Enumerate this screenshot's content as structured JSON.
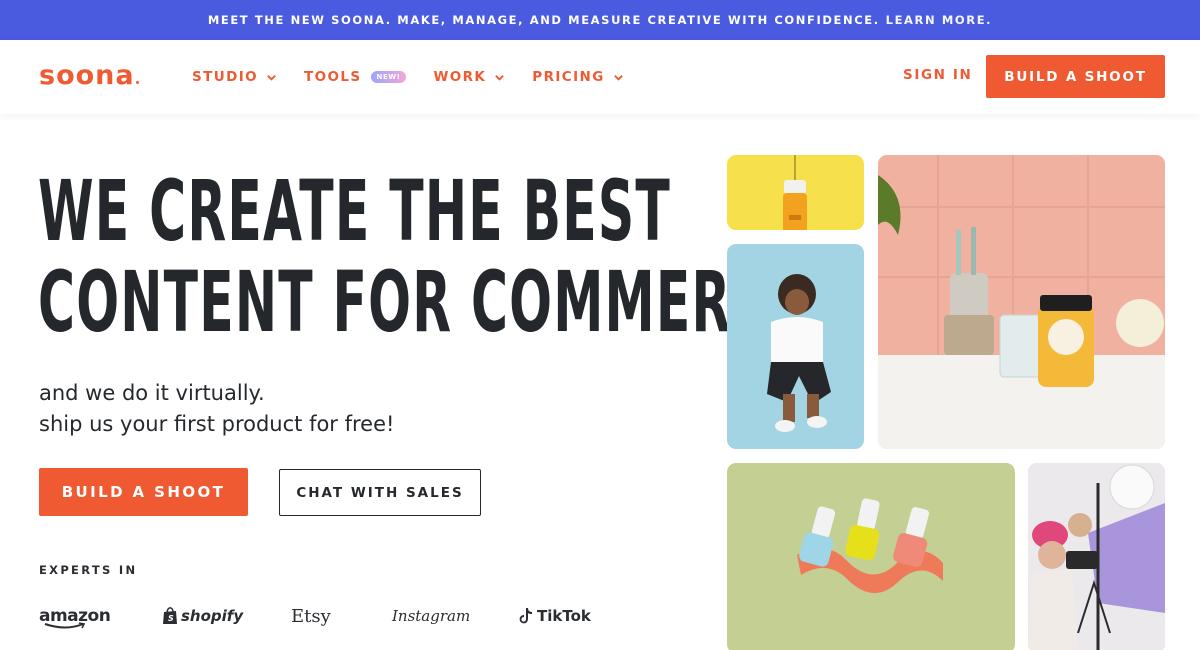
{
  "announcement": {
    "text": "MEET THE NEW SOONA. MAKE, MANAGE, AND MEASURE CREATIVE WITH CONFIDENCE.",
    "link": "LEARN MORE."
  },
  "header": {
    "logo": "soona",
    "nav": [
      {
        "label": "STUDIO",
        "icon": "chevron-down-icon"
      },
      {
        "label": "TOOLS",
        "badge": "NEW!"
      },
      {
        "label": "WORK",
        "icon": "chevron-down-icon"
      },
      {
        "label": "PRICING",
        "icon": "chevron-down-icon"
      }
    ],
    "signin": "SIGN IN",
    "cta": "BUILD A SHOOT"
  },
  "hero": {
    "headline": [
      "WE CREATE THE BEST",
      "CONTENT FOR COMMERCE"
    ],
    "sub": [
      "and we do it virtually.",
      "ship us your first product for free!"
    ],
    "primary_button": "BUILD A SHOOT",
    "secondary_button": "CHAT WITH SALES",
    "experts_label": "EXPERTS IN",
    "brands": [
      "amazon",
      "shopify",
      "Etsy",
      "Instagram",
      "TikTok"
    ]
  },
  "colors": {
    "brand": "#ef5a32",
    "announcement_bg": "#4a5be0",
    "text_dark": "#24272b"
  }
}
